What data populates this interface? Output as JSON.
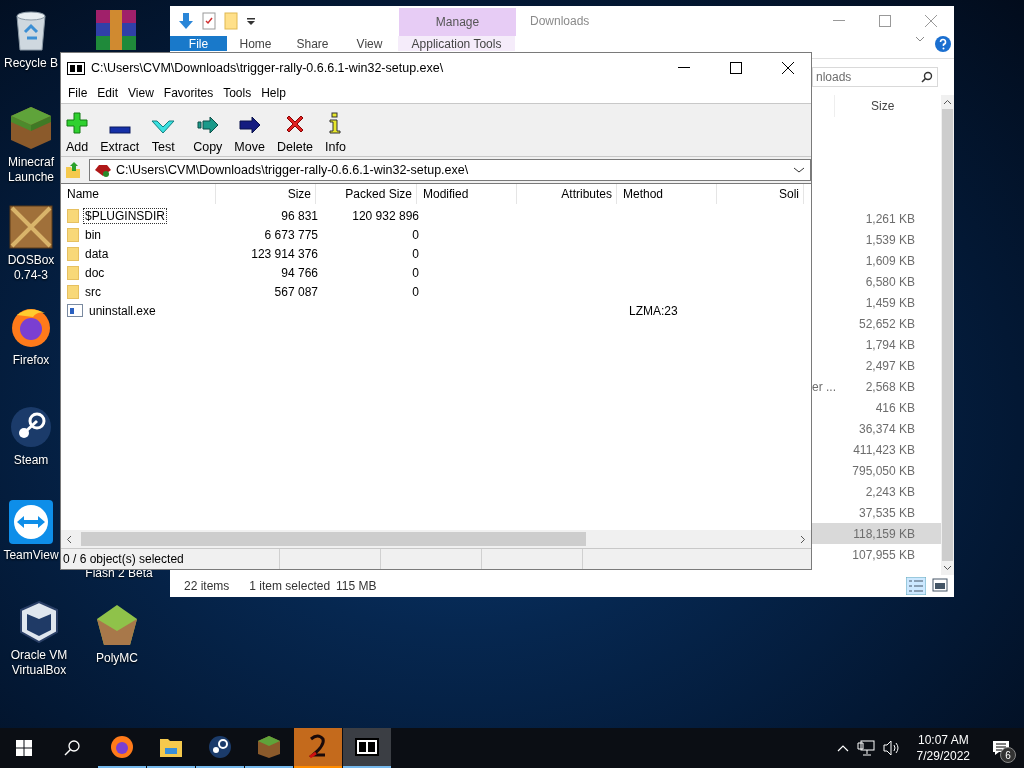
{
  "desktop_icons": [
    {
      "label": "Recycle B"
    },
    {
      "label": "Minecraf Launche"
    },
    {
      "label": "DOSBox 0.74-3"
    },
    {
      "label": "Firefox"
    },
    {
      "label": "Steam"
    },
    {
      "label": "TeamView"
    },
    {
      "label": "Flash 2 Beta"
    },
    {
      "label": "Oracle VM VirtualBox"
    },
    {
      "label": "PolyMC"
    }
  ],
  "explorer": {
    "title": "Downloads",
    "context_group": "Manage",
    "tabs": [
      {
        "label": "File",
        "kind": "file"
      },
      {
        "label": "Home",
        "kind": "tab"
      },
      {
        "label": "Share",
        "kind": "tab"
      },
      {
        "label": "View",
        "kind": "tab"
      },
      {
        "label": "Application Tools",
        "kind": "contextual"
      }
    ],
    "search": {
      "placeholder": "nloads"
    },
    "size_header": "Size",
    "rows": [
      {
        "size": "1,261 KB",
        "selected": false
      },
      {
        "size": "1,539 KB",
        "selected": false
      },
      {
        "size": "1,609 KB",
        "selected": false
      },
      {
        "size": "6,580 KB",
        "selected": false
      },
      {
        "size": "1,459 KB",
        "selected": false
      },
      {
        "size": "52,652 KB",
        "selected": false
      },
      {
        "size": "1,794 KB",
        "selected": false
      },
      {
        "size": "2,497 KB",
        "selected": false
      },
      {
        "size": "2,568 KB",
        "selected": false,
        "type": "er ..."
      },
      {
        "size": "416 KB",
        "selected": false
      },
      {
        "size": "36,374 KB",
        "selected": false
      },
      {
        "size": "411,423 KB",
        "selected": false
      },
      {
        "size": "795,050 KB",
        "selected": false
      },
      {
        "size": "2,243 KB",
        "selected": false
      },
      {
        "size": "37,535 KB",
        "selected": false
      },
      {
        "size": "118,159 KB",
        "selected": true
      },
      {
        "size": "107,955 KB",
        "selected": false
      }
    ],
    "status": {
      "count": "22 items",
      "selection": "1 item selected",
      "selection_size": "115 MB"
    }
  },
  "sevenzip": {
    "title": "C:\\Users\\CVM\\Downloads\\trigger-rally-0.6.6.1-win32-setup.exe\\",
    "menu": [
      "File",
      "Edit",
      "View",
      "Favorites",
      "Tools",
      "Help"
    ],
    "toolbar": [
      {
        "label": "Add"
      },
      {
        "label": "Extract"
      },
      {
        "label": "Test"
      },
      {
        "label": "Copy"
      },
      {
        "label": "Move"
      },
      {
        "label": "Delete"
      },
      {
        "label": "Info"
      }
    ],
    "address": "C:\\Users\\CVM\\Downloads\\trigger-rally-0.6.6.1-win32-setup.exe\\",
    "columns": [
      "Name",
      "Size",
      "Packed Size",
      "Modified",
      "Attributes",
      "Method",
      "Soli"
    ],
    "rows": [
      {
        "kind": "folder",
        "name": "$PLUGINSDIR",
        "size": "96 831",
        "packed": "120 932 896",
        "focused": true
      },
      {
        "kind": "folder",
        "name": "bin",
        "size": "6 673 775",
        "packed": "0",
        "focused": false
      },
      {
        "kind": "folder",
        "name": "data",
        "size": "123 914 376",
        "packed": "0",
        "focused": false
      },
      {
        "kind": "folder",
        "name": "doc",
        "size": "94 766",
        "packed": "0",
        "focused": false
      },
      {
        "kind": "folder",
        "name": "src",
        "size": "567 087",
        "packed": "0",
        "focused": false
      },
      {
        "kind": "file",
        "name": "uninstall.exe",
        "method": "LZMA:23",
        "focused": false
      }
    ],
    "status": "0 / 6 object(s) selected"
  },
  "taskbar": {
    "apps": [
      {
        "active": false,
        "flashing": false
      },
      {
        "active": false,
        "flashing": false
      },
      {
        "active": false,
        "flashing": false
      },
      {
        "active": false,
        "flashing": false
      },
      {
        "active": false,
        "flashing": true
      },
      {
        "active": true,
        "flashing": false
      }
    ],
    "time": "10:07 AM",
    "date": "7/29/2022",
    "notifications": "6"
  }
}
